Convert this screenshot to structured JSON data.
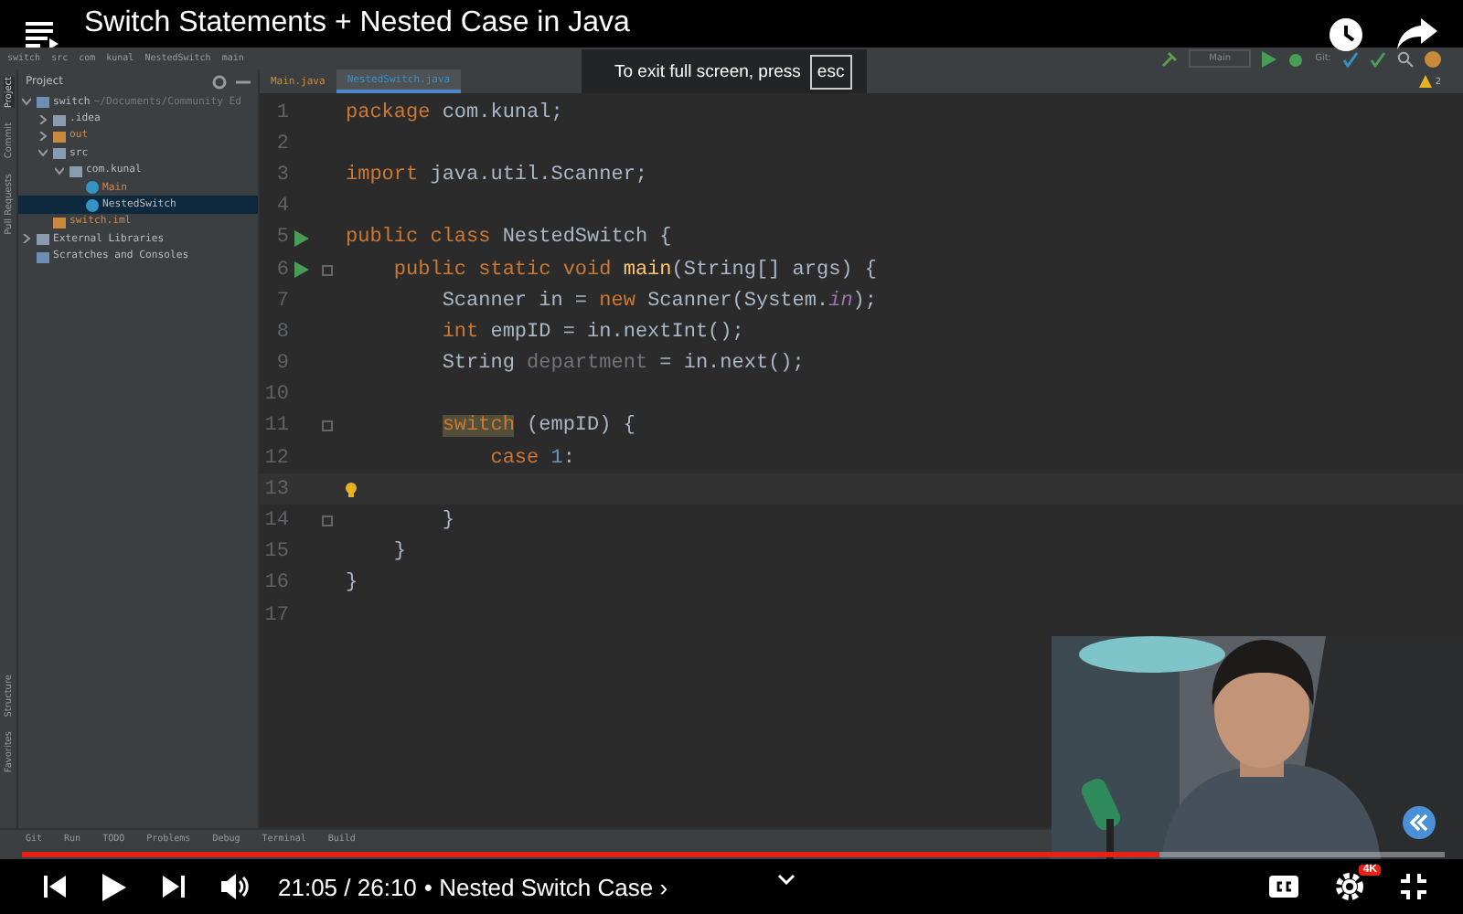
{
  "player": {
    "title": "Switch Statements + Nested Case in Java",
    "notice": "To exit full screen, press",
    "notice_key": "esc",
    "time": "21:05 / 26:10",
    "chapter": "• Nested Switch Case ›",
    "quality_badge": "4K",
    "progress": {
      "level": 0.8
    }
  },
  "ide": {
    "breadcrumbs": [
      "switch",
      "src",
      "com",
      "kunal",
      "NestedSwitch",
      "main"
    ],
    "run_config": "Main",
    "vcs_label": "Git:",
    "warnings": "2",
    "side_tabs_top": [
      {
        "label": "Project",
        "selected": true
      },
      {
        "label": "Commit",
        "selected": false
      },
      {
        "label": "Pull Requests",
        "selected": false
      }
    ],
    "side_tabs_bottom": [
      {
        "label": "Structure",
        "selected": false
      },
      {
        "label": "Favorites",
        "selected": false
      }
    ],
    "project_header": "Project",
    "editor_tabs": [
      {
        "label": "Main.java",
        "selected": false
      },
      {
        "label": "NestedSwitch.java",
        "selected": true
      }
    ],
    "tree": [
      {
        "label": "switch",
        "note": "~/Documents/Community Ed",
        "kind": "module",
        "expanded": true,
        "selected": false,
        "children": [
          {
            "label": ".idea",
            "kind": "folder",
            "expanded": false,
            "selected": false
          },
          {
            "label": "out",
            "kind": "excluded",
            "expanded": false,
            "selected": false
          },
          {
            "label": "src",
            "kind": "folder",
            "expanded": true,
            "selected": false,
            "children": [
              {
                "label": "com.kunal",
                "kind": "package",
                "expanded": true,
                "selected": false,
                "children": [
                  {
                    "label": "Main",
                    "kind": "class",
                    "selected": false
                  },
                  {
                    "label": "NestedSwitch",
                    "kind": "class",
                    "selected": true
                  }
                ]
              }
            ]
          },
          {
            "label": "switch.iml",
            "kind": "file",
            "selected": false
          }
        ]
      },
      {
        "label": "External Libraries",
        "kind": "library",
        "expanded": false,
        "selected": false
      },
      {
        "label": "Scratches and Consoles",
        "kind": "scratches",
        "selected": false
      }
    ],
    "code": [
      {
        "number": "1",
        "tokens": [
          {
            "kind": "kw",
            "t": "package"
          },
          {
            "kind": "p",
            "t": " com.kunal;"
          }
        ]
      },
      {
        "number": "2"
      },
      {
        "number": "3",
        "tokens": [
          {
            "kind": "kw",
            "t": "import"
          },
          {
            "kind": "p",
            "t": " java.util.Scanner;"
          }
        ]
      },
      {
        "number": "4"
      },
      {
        "number": "5",
        "run": true,
        "tokens": [
          {
            "kind": "kw",
            "t": "public class"
          },
          {
            "kind": "p",
            "t": " NestedSwitch {"
          }
        ]
      },
      {
        "number": "6",
        "run": true,
        "fold": true,
        "tokens": [
          {
            "kind": "kw",
            "t": "    public static void"
          },
          {
            "kind": "fn",
            "t": " main"
          },
          {
            "kind": "p",
            "t": "(String[] args) {"
          }
        ]
      },
      {
        "number": "7",
        "tokens": [
          {
            "kind": "p",
            "t": "        Scanner in = "
          },
          {
            "kind": "kw",
            "t": "new"
          },
          {
            "kind": "p",
            "t": " Scanner(System."
          },
          {
            "kind": "field",
            "t": "in"
          },
          {
            "kind": "p",
            "t": ");"
          }
        ]
      },
      {
        "number": "8",
        "tokens": [
          {
            "kind": "kw",
            "t": "        int"
          },
          {
            "kind": "p",
            "t": " empID = in.nextInt();"
          }
        ]
      },
      {
        "number": "9",
        "tokens": [
          {
            "kind": "p",
            "t": "        String "
          },
          {
            "kind": "unused",
            "t": "department"
          },
          {
            "kind": "p",
            "t": " = in.next();"
          }
        ]
      },
      {
        "number": "10"
      },
      {
        "number": "11",
        "fold": true,
        "tokens": [
          {
            "kind": "hl",
            "t": "        switch"
          },
          {
            "kind": "p",
            "t": " (empID) {"
          }
        ]
      },
      {
        "number": "12",
        "tokens": [
          {
            "kind": "kw",
            "t": "            case"
          },
          {
            "kind": "num",
            "t": " 1"
          },
          {
            "kind": "p",
            "t": ":"
          }
        ]
      },
      {
        "number": "13",
        "current": true,
        "bulb": true
      },
      {
        "number": "14",
        "fold": true,
        "tokens": [
          {
            "kind": "p",
            "t": "        }"
          }
        ]
      },
      {
        "number": "15",
        "tokens": [
          {
            "kind": "p",
            "t": "    }"
          }
        ]
      },
      {
        "number": "16",
        "tokens": [
          {
            "kind": "p",
            "t": "}"
          }
        ]
      },
      {
        "number": "17"
      }
    ],
    "tool_tabs": [
      "Git",
      "Run",
      "TODO",
      "Problems",
      "Debug",
      "Terminal",
      "Build"
    ]
  }
}
